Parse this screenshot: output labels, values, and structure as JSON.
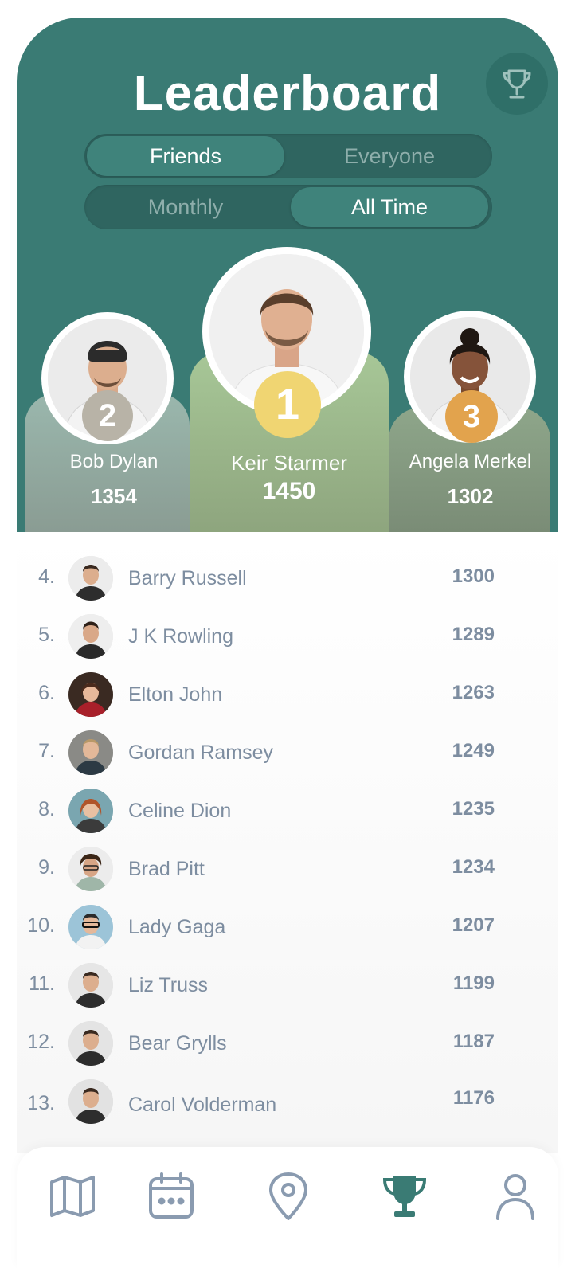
{
  "header": {
    "title": "Leaderboard",
    "scope_tabs": [
      {
        "label": "Friends",
        "active": true
      },
      {
        "label": "Everyone",
        "active": false
      }
    ],
    "period_tabs": [
      {
        "label": "Monthly",
        "active": false
      },
      {
        "label": "All Time",
        "active": true
      }
    ]
  },
  "podium": {
    "first": {
      "rank": "1",
      "name": "Keir Starmer",
      "score": "1450"
    },
    "second": {
      "rank": "2",
      "name": "Bob Dylan",
      "score": "1354"
    },
    "third": {
      "rank": "3",
      "name": "Angela Merkel",
      "score": "1302"
    }
  },
  "list": [
    {
      "rank": "4.",
      "name": "Barry Russell",
      "score": "1300"
    },
    {
      "rank": "5.",
      "name": " J K Rowling",
      "score": "1289"
    },
    {
      "rank": "6.",
      "name": "Elton John",
      "score": "1263"
    },
    {
      "rank": "7.",
      "name": "Gordan Ramsey",
      "score": "1249"
    },
    {
      "rank": "8.",
      "name": "Celine Dion",
      "score": "1235"
    },
    {
      "rank": "9.",
      "name": "Brad Pitt",
      "score": "1234"
    },
    {
      "rank": "10.",
      "name": "Lady Gaga",
      "score": "1207"
    },
    {
      "rank": "11.",
      "name": "Liz Truss",
      "score": "1199"
    },
    {
      "rank": "12.",
      "name": "Bear Grylls",
      "score": "1187"
    },
    {
      "rank": "13.",
      "name": "Carol Volderman",
      "score": "1176"
    }
  ],
  "nav": [
    {
      "icon": "map-icon",
      "active": false
    },
    {
      "icon": "calendar-icon",
      "active": false
    },
    {
      "icon": "location-pin-icon",
      "active": false
    },
    {
      "icon": "trophy-icon",
      "active": true
    },
    {
      "icon": "profile-icon",
      "active": false
    }
  ],
  "colors": {
    "header_bg": "#3a7b74",
    "first_badge": "#f0d572",
    "second_badge": "#b8b3a7",
    "third_badge": "#e2a34d",
    "text_muted": "#7d8da0",
    "nav_active": "#3a7b74",
    "nav_inactive": "#8a9bb0"
  }
}
